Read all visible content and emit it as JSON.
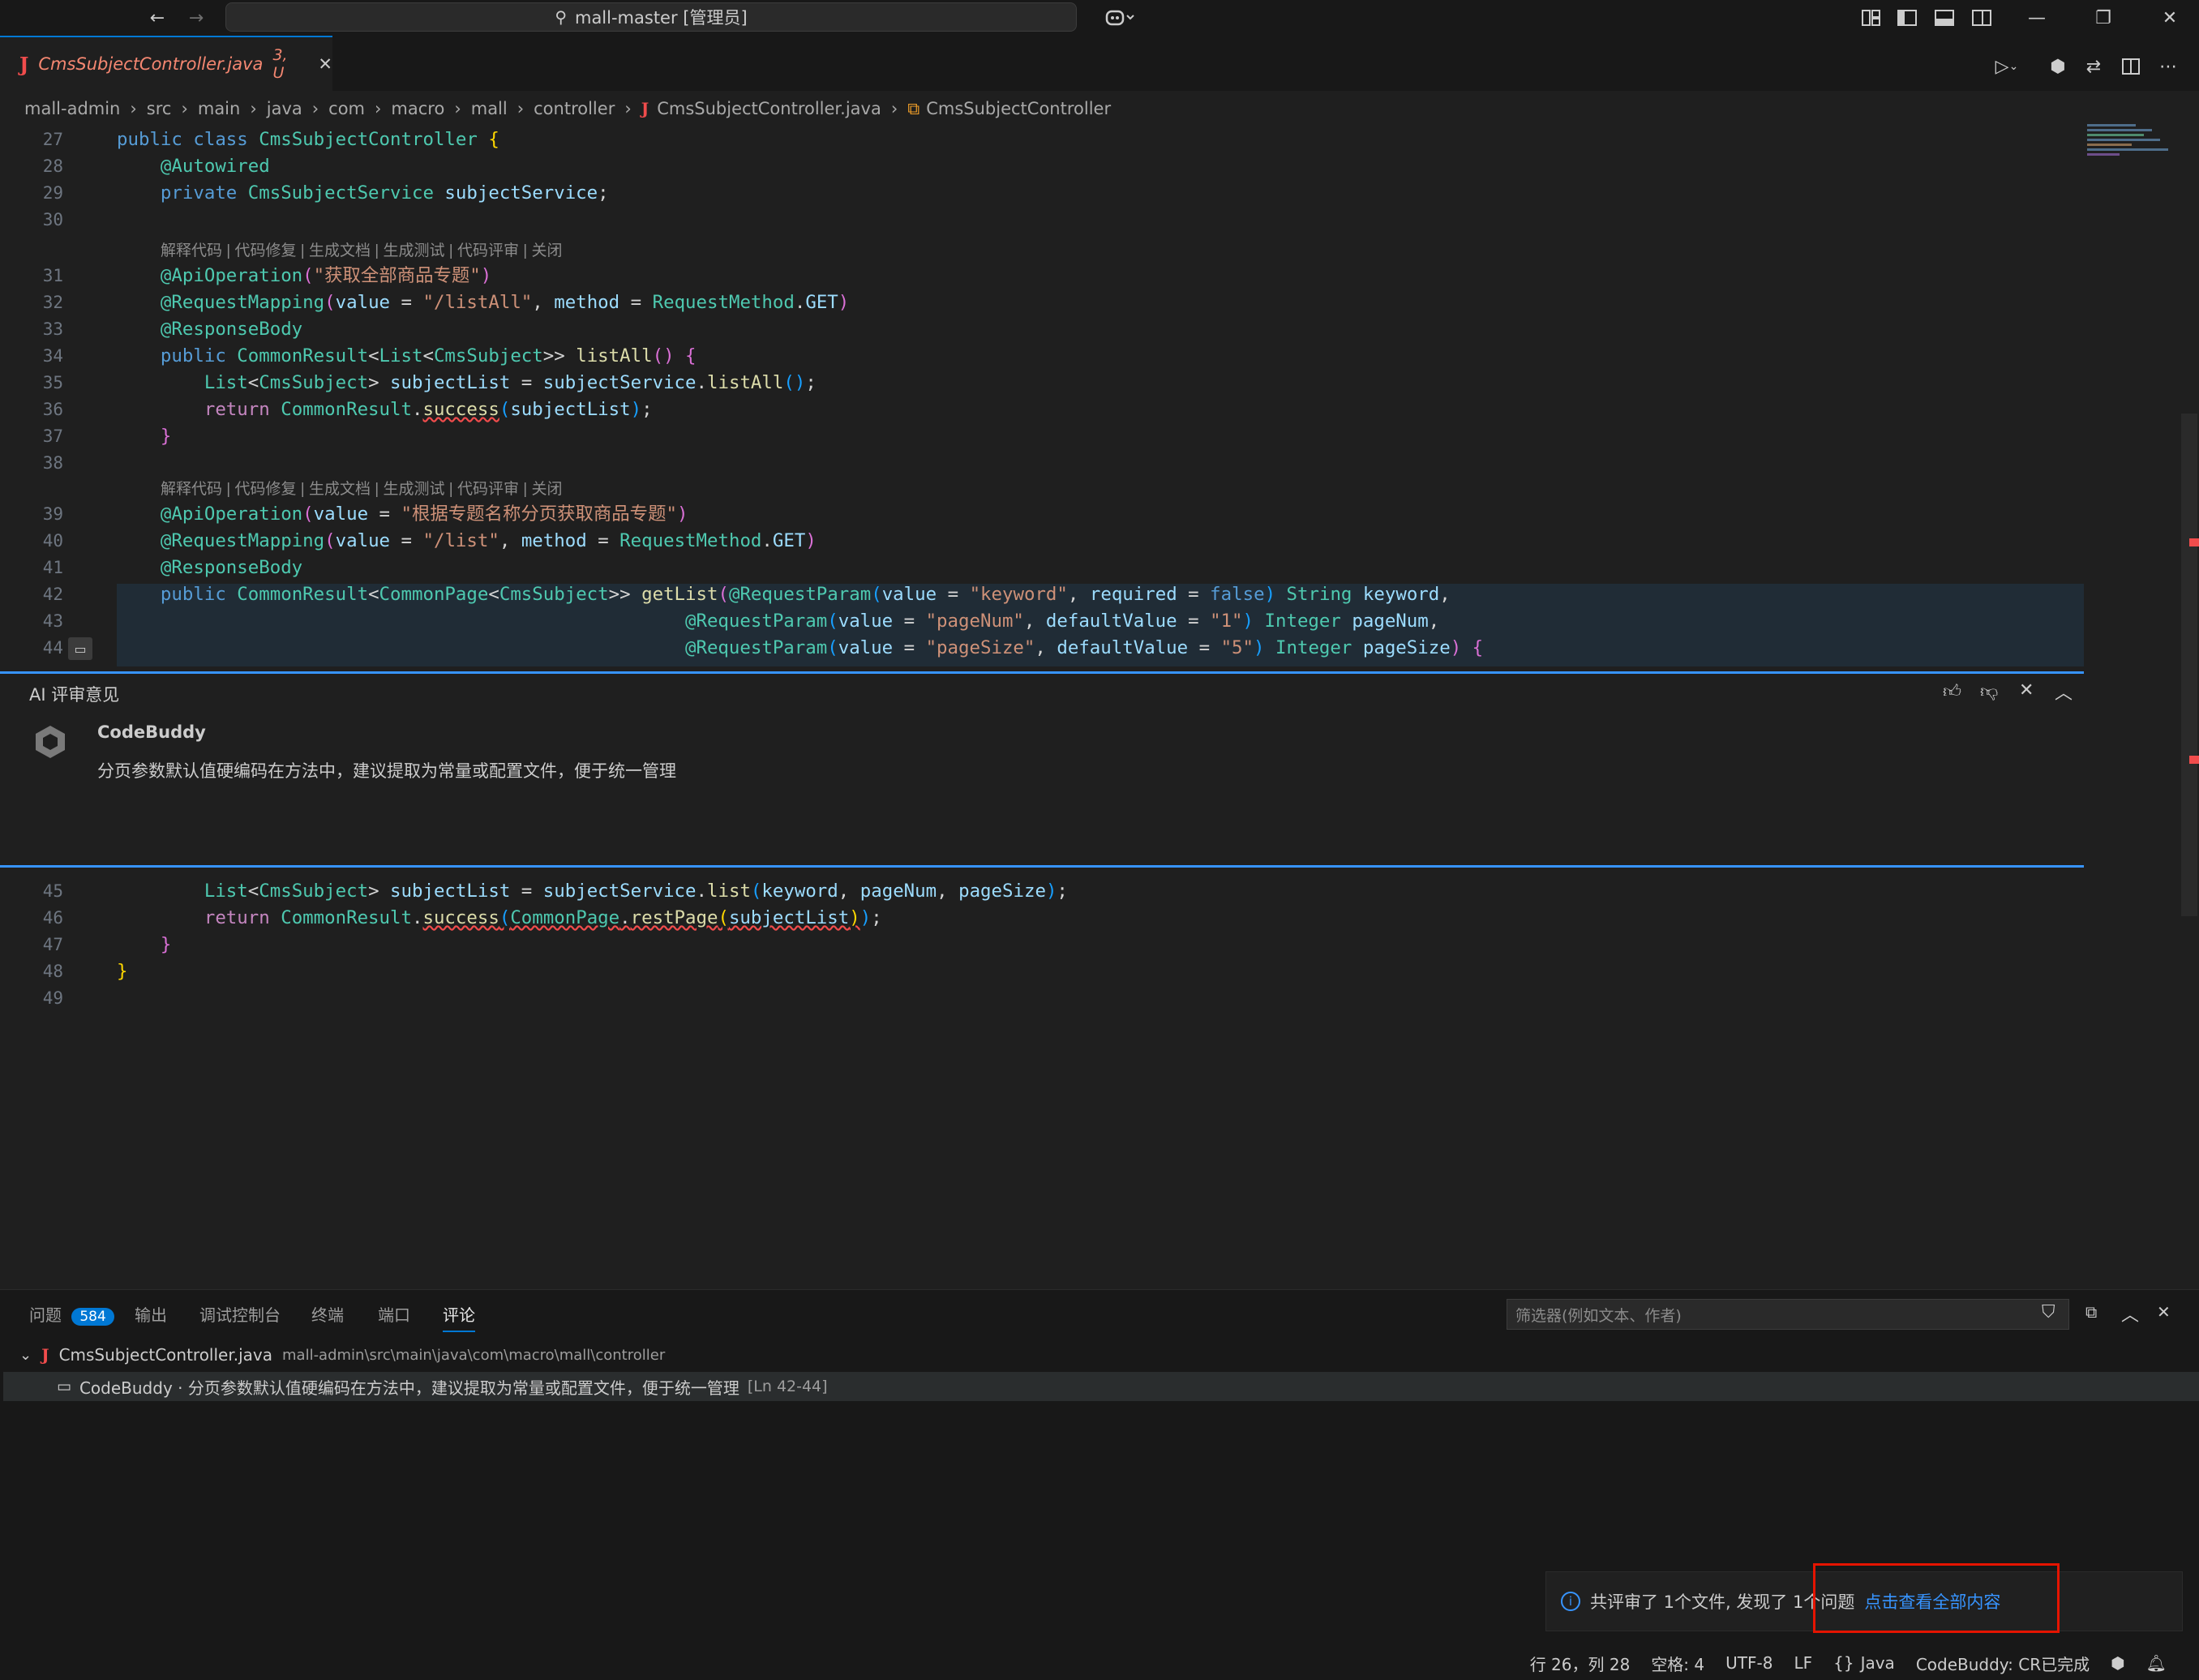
{
  "titlebar": {
    "search_text": "mall-master [管理员]"
  },
  "tab": {
    "filename": "CmsSubjectController.java",
    "badge": "3, U"
  },
  "breadcrumb": [
    "mall-admin",
    "src",
    "main",
    "java",
    "com",
    "macro",
    "mall",
    "controller",
    "CmsSubjectController.java",
    "CmsSubjectController"
  ],
  "codelens": "解释代码 | 代码修复 | 生成文档 | 生成测试 | 代码评审 | 关闭",
  "line_numbers": [
    "27",
    "28",
    "29",
    "30",
    "31",
    "32",
    "33",
    "34",
    "35",
    "36",
    "37",
    "38",
    "39",
    "40",
    "41",
    "42",
    "43",
    "44",
    "45",
    "46",
    "47",
    "48",
    "49"
  ],
  "review": {
    "title": "AI 评审意见",
    "author": "CodeBuddy",
    "comment": "分页参数默认值硬编码在方法中，建议提取为常量或配置文件，便于统一管理"
  },
  "panel": {
    "tabs": [
      "问题",
      "输出",
      "调试控制台",
      "终端",
      "端口",
      "评论"
    ],
    "problems_count": "584",
    "filter_placeholder": "筛选器(例如文本、作者)",
    "file_name": "CmsSubjectController.java",
    "file_path": "mall-admin\\src\\main\\java\\com\\macro\\mall\\controller",
    "item_text": "CodeBuddy · 分页参数默认值硬编码在方法中，建议提取为常量或配置文件，便于统一管理",
    "item_range": "[Ln 42-44]"
  },
  "notification": {
    "text": "共评审了 1个文件, 发现了 1个问题",
    "link": "点击查看全部内容"
  },
  "statusbar": {
    "position": "行 26，列 28",
    "spaces": "空格: 4",
    "encoding": "UTF-8",
    "eol": "LF",
    "language": "Java",
    "codebuddy": "CodeBuddy: CR已完成"
  },
  "colors": {
    "accent": "#0078d4",
    "link": "#3794ff",
    "highlight_box": "#e51400"
  }
}
